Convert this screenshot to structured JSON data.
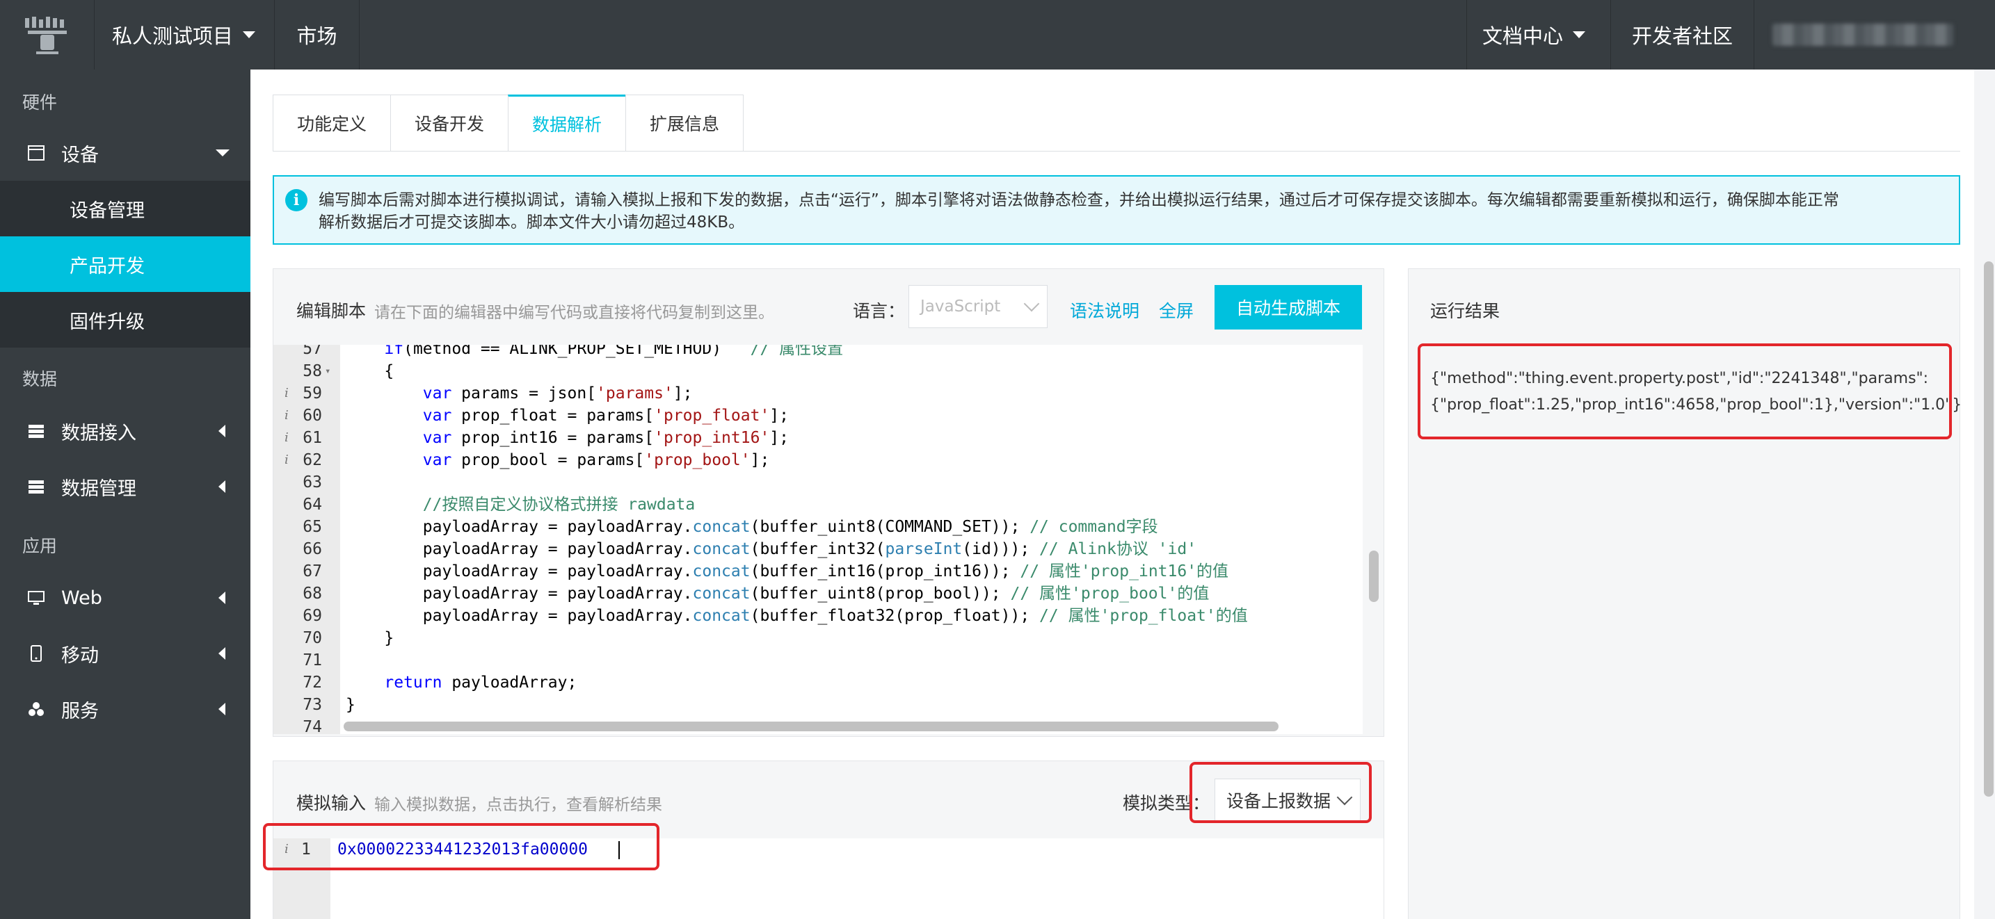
{
  "topbar": {
    "project": "私人测试项目",
    "market": "市场",
    "docs": "文档中心",
    "community": "开发者社区"
  },
  "sidebar": {
    "sections": [
      "硬件",
      "数据",
      "应用"
    ],
    "device": "设备",
    "sub_items": [
      "设备管理",
      "产品开发",
      "固件升级"
    ],
    "data_access": "数据接入",
    "data_manage": "数据管理",
    "web": "Web",
    "mobile": "移动",
    "service": "服务"
  },
  "tabs": [
    "功能定义",
    "设备开发",
    "数据解析",
    "扩展信息"
  ],
  "active_tab": "数据解析",
  "notice": {
    "line1": "编写脚本后需对脚本进行模拟调试，请输入模拟上报和下发的数据，点击“运行”，脚本引擎将对语法做静态检查，并给出模拟运行结果，通过后才可保存提交该脚本。每次编辑都需要重新模拟和运行，确保脚本能正常",
    "line2": "解析数据后才可提交该脚本。脚本文件大小请勿超过48KB。"
  },
  "editor": {
    "title": "编辑脚本",
    "hint": "请在下面的编辑器中编写代码或直接将代码复制到这里。",
    "lang_label": "语言：",
    "lang_value": "JavaScript",
    "syntax_link": "语法说明",
    "fullscreen_link": "全屏",
    "auto_btn": "自动生成脚本",
    "lines": [
      {
        "n": "57",
        "ann": "",
        "fold": false,
        "indent": "    ",
        "parts": [
          [
            "kw",
            "if"
          ],
          [
            "",
            "(method == ALINK_PROP_SET_METHOD)   "
          ],
          [
            "cm",
            "// 属性设置"
          ]
        ]
      },
      {
        "n": "58",
        "ann": "",
        "fold": true,
        "indent": "    ",
        "parts": [
          [
            "",
            "{"
          ]
        ]
      },
      {
        "n": "59",
        "ann": "i",
        "fold": false,
        "indent": "        ",
        "parts": [
          [
            "kw",
            "var"
          ],
          [
            "",
            " params = json["
          ],
          [
            "str",
            "'params'"
          ],
          [
            "",
            "];"
          ]
        ]
      },
      {
        "n": "60",
        "ann": "i",
        "fold": false,
        "indent": "        ",
        "parts": [
          [
            "kw",
            "var"
          ],
          [
            "",
            " prop_float = params["
          ],
          [
            "str",
            "'prop_float'"
          ],
          [
            "",
            "];"
          ]
        ]
      },
      {
        "n": "61",
        "ann": "i",
        "fold": false,
        "indent": "        ",
        "parts": [
          [
            "kw",
            "var"
          ],
          [
            "",
            " prop_int16 = params["
          ],
          [
            "str",
            "'prop_int16'"
          ],
          [
            "",
            "];"
          ]
        ]
      },
      {
        "n": "62",
        "ann": "i",
        "fold": false,
        "indent": "        ",
        "parts": [
          [
            "kw",
            "var"
          ],
          [
            "",
            " prop_bool = params["
          ],
          [
            "str",
            "'prop_bool'"
          ],
          [
            "",
            "];"
          ]
        ]
      },
      {
        "n": "63",
        "ann": "",
        "fold": false,
        "indent": "",
        "parts": []
      },
      {
        "n": "64",
        "ann": "",
        "fold": false,
        "indent": "        ",
        "parts": [
          [
            "cm",
            "//按照自定义协议格式拼接 rawdata"
          ]
        ]
      },
      {
        "n": "65",
        "ann": "",
        "fold": false,
        "indent": "        ",
        "parts": [
          [
            "",
            "payloadArray = payloadArray."
          ],
          [
            "fn",
            "concat"
          ],
          [
            "",
            "(buffer_uint8(COMMAND_SET)); "
          ],
          [
            "cm",
            "// command字段"
          ]
        ]
      },
      {
        "n": "66",
        "ann": "",
        "fold": false,
        "indent": "        ",
        "parts": [
          [
            "",
            "payloadArray = payloadArray."
          ],
          [
            "fn",
            "concat"
          ],
          [
            "",
            "(buffer_int32("
          ],
          [
            "fn",
            "parseInt"
          ],
          [
            "",
            "(id))); "
          ],
          [
            "cm",
            "// Alink协议 'id'"
          ]
        ]
      },
      {
        "n": "67",
        "ann": "",
        "fold": false,
        "indent": "        ",
        "parts": [
          [
            "",
            "payloadArray = payloadArray."
          ],
          [
            "fn",
            "concat"
          ],
          [
            "",
            "(buffer_int16(prop_int16)); "
          ],
          [
            "cm",
            "// 属性'prop_int16'的值"
          ]
        ]
      },
      {
        "n": "68",
        "ann": "",
        "fold": false,
        "indent": "        ",
        "parts": [
          [
            "",
            "payloadArray = payloadArray."
          ],
          [
            "fn",
            "concat"
          ],
          [
            "",
            "(buffer_uint8(prop_bool)); "
          ],
          [
            "cm",
            "// 属性'prop_bool'的值"
          ]
        ]
      },
      {
        "n": "69",
        "ann": "",
        "fold": false,
        "indent": "        ",
        "parts": [
          [
            "",
            "payloadArray = payloadArray."
          ],
          [
            "fn",
            "concat"
          ],
          [
            "",
            "(buffer_float32(prop_float)); "
          ],
          [
            "cm",
            "// 属性'prop_float'的值"
          ]
        ]
      },
      {
        "n": "70",
        "ann": "",
        "fold": false,
        "indent": "    ",
        "parts": [
          [
            "",
            "}"
          ]
        ]
      },
      {
        "n": "71",
        "ann": "",
        "fold": false,
        "indent": "",
        "parts": []
      },
      {
        "n": "72",
        "ann": "",
        "fold": false,
        "indent": "    ",
        "parts": [
          [
            "kw",
            "return"
          ],
          [
            "",
            " payloadArray;"
          ]
        ]
      },
      {
        "n": "73",
        "ann": "",
        "fold": false,
        "indent": "",
        "parts": [
          [
            "",
            "}"
          ]
        ]
      },
      {
        "n": "74",
        "ann": "",
        "fold": false,
        "indent": "",
        "parts": []
      }
    ]
  },
  "simulate": {
    "title": "模拟输入",
    "hint": "输入模拟数据，点击执行，查看解析结果",
    "type_label": "模拟类型：",
    "type_value": "设备上报数据",
    "line_ann": "i",
    "line_no": "1",
    "input_value": "0x00002233441232013fa00000"
  },
  "result": {
    "title": "运行结果",
    "line1": "{\"method\":\"thing.event.property.post\",\"id\":\"2241348\",\"params\":",
    "line2": "{\"prop_float\":1.25,\"prop_int16\":4658,\"prop_bool\":1},\"version\":\"1.0\"}"
  },
  "colors": {
    "accent": "#00c1de",
    "highlight_box": "#e3262b",
    "sidebar_bg": "#373d41"
  }
}
